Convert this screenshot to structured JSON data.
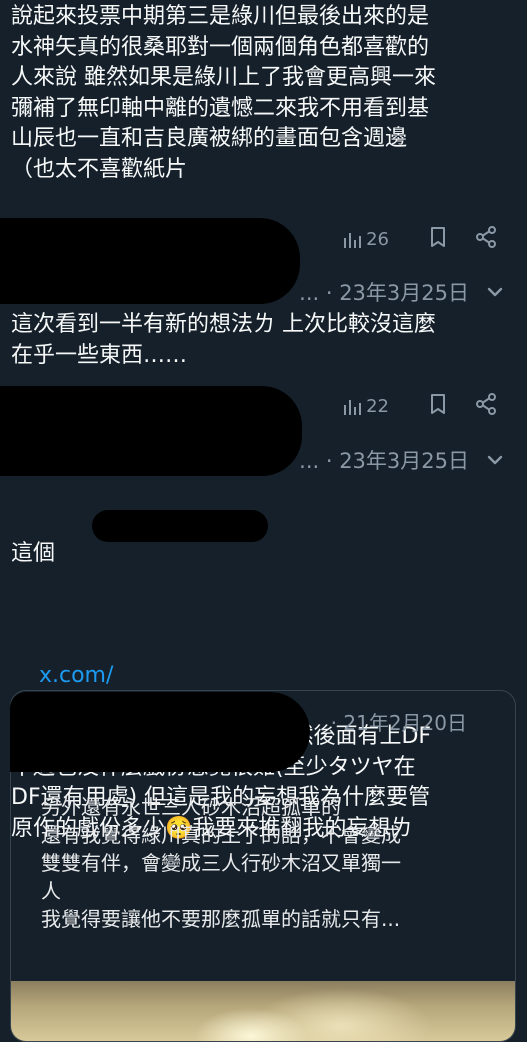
{
  "tweets": [
    {
      "text": "說起來投票中期第三是綠川但最後出來的是\n水神矢真的很桑耶對一個兩個角色都喜歡的\n人來說 雖然如果是綠川上了我會更高興一來\n彌補了無印軸中離的遺憾二來我不用看到基\n山辰也一直和吉良廣被綁的畫面包含週邊\n（也太不喜歡紙片",
      "views": "26"
    },
    {
      "meta": "... · 23年3月25日",
      "text": "這次看到一半有新的想法ㄌ 上次比較沒這麼\n在乎一些東西……",
      "views": "22"
    },
    {
      "meta": "... · 23年3月25日",
      "text_line1": "這個",
      "link_prefix": "x.com/",
      "link_suffix": "...",
      "text": "原本只想說砂的位置是GK 雖然後面有上DF\n不過也沒什麼戲份感覺很難(至少タツヤ在\nDF還有用處) 但這是我的妄想我為什麼要管\n原作的戲份多少🥺我要來推翻我的妄想ㄌ"
    }
  ],
  "quote": {
    "date": "· 21年2月20日",
    "text": "另外還有永世三人砂木沼超孤單的\n還有我覺得綠川真的上了的話，不會變成\n雙雙有伴，會變成三人行砂木沼又單獨一\n人\n我覺得要讓他不要那麼孤單的話就只有..."
  },
  "icons": {
    "views": "bar-chart-icon",
    "bookmark": "bookmark-icon",
    "share": "share-icon",
    "more": "chevron-down-icon"
  },
  "colors": {
    "background": "#15202b",
    "text": "#f7f9f9",
    "muted": "#8b98a5",
    "link": "#1d9bf0",
    "border": "#38444d"
  }
}
